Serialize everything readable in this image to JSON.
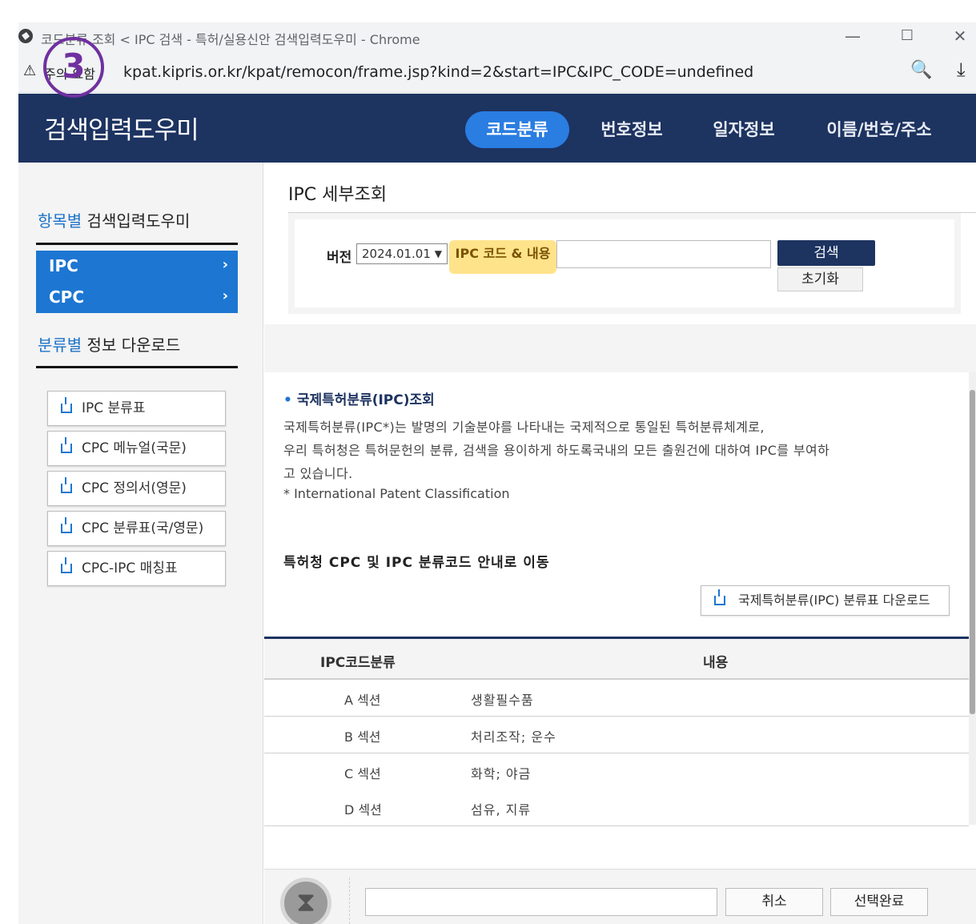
{
  "browser": {
    "tab_title": "코드분류 조회 < IPC 검색 - 특허/실용신안 검색입력도우미 - Chrome",
    "security_label": "주의 요함",
    "url": "kpat.kipris.or.kr/kpat/remocon/frame.jsp?kind=2&start=IPC&IPC_CODE=undefined",
    "minimize": "—",
    "maximize": "☐",
    "close": "✕",
    "zoom_icon": "🔍",
    "download_icon": "⤓"
  },
  "annotation": {
    "step_marker": "3"
  },
  "header": {
    "logo": "검색입력도우미",
    "tabs": [
      {
        "label": "코드분류",
        "active": true
      },
      {
        "label": "번호정보",
        "active": false
      },
      {
        "label": "일자정보",
        "active": false
      },
      {
        "label": "이름/번호/주소",
        "active": false
      }
    ]
  },
  "sidebar": {
    "section1": {
      "highlight": "항목별",
      "rest": " 검색입력도우미"
    },
    "menu": [
      {
        "label": "IPC",
        "chevron": "›"
      },
      {
        "label": "CPC",
        "chevron": "›"
      }
    ],
    "section2": {
      "highlight": "분류별",
      "rest": " 정보 다운로드"
    },
    "downloads": [
      "IPC 분류표",
      "CPC 메뉴얼(국문)",
      "CPC 정의서(영문)",
      "CPC 분류표(국/영문)",
      "CPC-IPC 매칭표"
    ]
  },
  "main": {
    "title": "IPC 세부조회",
    "search": {
      "version_label": "버전",
      "version_value": "2024.01.01",
      "code_label": "IPC 코드 & 내용",
      "input_value": "",
      "search_button": "검색",
      "reset_button": "초기화"
    },
    "info": {
      "heading": "국제특허분류(IPC)조회",
      "lines": [
        "국제특허분류(IPC*)는 발명의 기술분야를 나타내는 국제적으로 통일된 특허분류체계로,",
        "우리 특허청은 특허문헌의 분류, 검색을 용이하게 하도록국내의 모든 출원건에 대하여 IPC를 부여하",
        "고 있습니다.",
        "* International Patent Classification"
      ],
      "link_text": "특허청 CPC 및 IPC 분류코드 안내로 이동",
      "download_button": "국제특허분류(IPC) 분류표 다운로드"
    },
    "table": {
      "headers": [
        "IPC코드분류",
        "내용"
      ],
      "rows": [
        {
          "code": "A 섹션",
          "desc": "생활필수품"
        },
        {
          "code": "B 섹션",
          "desc": "처리조작; 운수"
        },
        {
          "code": "C 섹션",
          "desc": "화학; 야금"
        },
        {
          "code": "D 섹션",
          "desc": "섬유, 지류"
        }
      ]
    },
    "footer": {
      "selected_value": "",
      "cancel_button": "취소",
      "done_button": "선택완료"
    }
  }
}
